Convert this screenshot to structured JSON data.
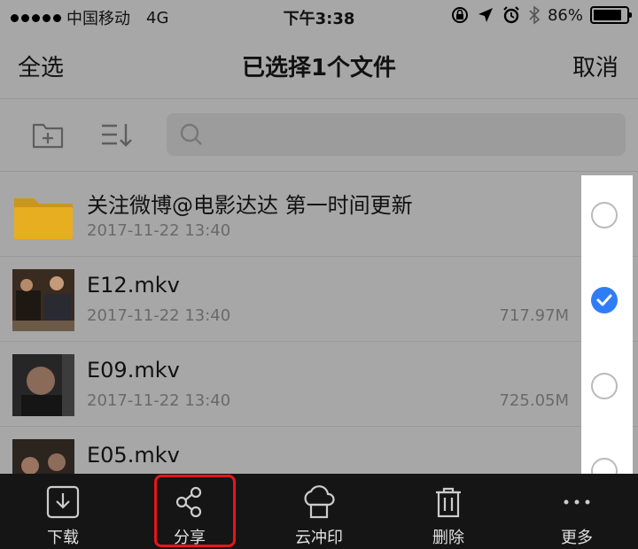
{
  "status_bar": {
    "carrier": "中国移动",
    "network": "4G",
    "time": "下午3:38",
    "battery": "86%",
    "battery_level": 0.86
  },
  "nav": {
    "select_all": "全选",
    "title": "已选择1个文件",
    "cancel": "取消"
  },
  "toolbar": {
    "new_folder_icon": "folder-plus-icon",
    "sort_icon": "sort-icon",
    "search_placeholder": ""
  },
  "files": [
    {
      "name": "关注微博@电影达达 第一时间更新",
      "date": "2017-11-22 13:40",
      "size": "",
      "type": "folder",
      "checked": false
    },
    {
      "name": "E12.mkv",
      "date": "2017-11-22 13:40",
      "size": "717.97M",
      "type": "video",
      "checked": true
    },
    {
      "name": "E09.mkv",
      "date": "2017-11-22 13:40",
      "size": "725.05M",
      "type": "video",
      "checked": false
    },
    {
      "name": "E05.mkv",
      "date": "",
      "size": "",
      "type": "video",
      "checked": false
    }
  ],
  "tabbar": {
    "download": "下载",
    "share": "分享",
    "print": "云冲印",
    "delete": "删除",
    "more": "更多"
  },
  "colors": {
    "accent": "#2f7df6",
    "highlight": "#e4161c",
    "folder": "#f0b020",
    "tabbar_bg": "#151515"
  }
}
